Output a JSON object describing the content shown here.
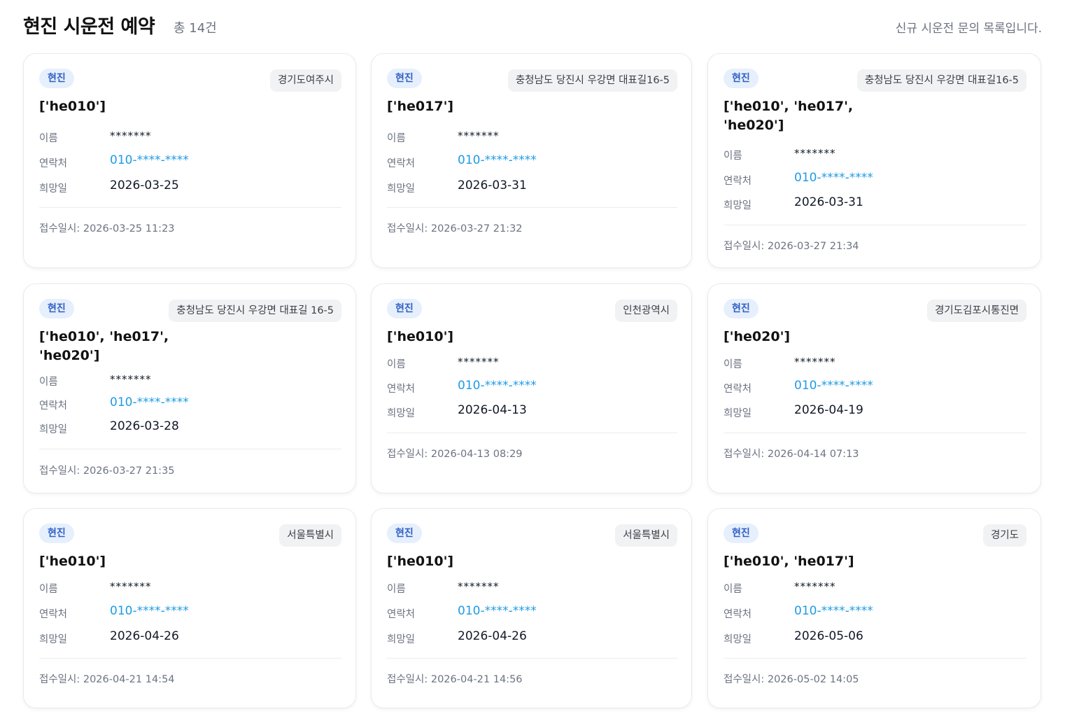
{
  "header": {
    "title": "현진 시운전 예약",
    "count": "총 14건",
    "subtitle": "신규 시운전 문의 목록입니다."
  },
  "labels": {
    "name": "이름",
    "contact": "연락처",
    "desired_date": "희망일"
  },
  "cards": [
    {
      "badge": "현진",
      "region": "경기도여주시",
      "equipment": "['he010']",
      "name": "*******",
      "phone": "010-****-****",
      "desired_date": "2026-03-25",
      "received": "접수일시: 2026-03-25 11:23"
    },
    {
      "badge": "현진",
      "region": "충청남도 당진시 우강면 대표길16-5",
      "equipment": "['he017']",
      "name": "*******",
      "phone": "010-****-****",
      "desired_date": "2026-03-31",
      "received": "접수일시: 2026-03-27 21:32"
    },
    {
      "badge": "현진",
      "region": "충청남도 당진시 우강면 대표길16-5",
      "equipment": "['he010', 'he017', 'he020']",
      "name": "*******",
      "phone": "010-****-****",
      "desired_date": "2026-03-31",
      "received": "접수일시: 2026-03-27 21:34"
    },
    {
      "badge": "현진",
      "region": "충청남도 당진시 우강면 대표길 16-5",
      "equipment": "['he010', 'he017', 'he020']",
      "name": "*******",
      "phone": "010-****-****",
      "desired_date": "2026-03-28",
      "received": "접수일시: 2026-03-27 21:35"
    },
    {
      "badge": "현진",
      "region": "인천광역시",
      "equipment": "['he010']",
      "name": "*******",
      "phone": "010-****-****",
      "desired_date": "2026-04-13",
      "received": "접수일시: 2026-04-13 08:29"
    },
    {
      "badge": "현진",
      "region": "경기도김포시통진면",
      "equipment": "['he020']",
      "name": "*******",
      "phone": "010-****-****",
      "desired_date": "2026-04-19",
      "received": "접수일시: 2026-04-14 07:13"
    },
    {
      "badge": "현진",
      "region": "서울특별시",
      "equipment": "['he010']",
      "name": "*******",
      "phone": "010-****-****",
      "desired_date": "2026-04-26",
      "received": "접수일시: 2026-04-21 14:54"
    },
    {
      "badge": "현진",
      "region": "서울특별시",
      "equipment": "['he010']",
      "name": "*******",
      "phone": "010-****-****",
      "desired_date": "2026-04-26",
      "received": "접수일시: 2026-04-21 14:56"
    },
    {
      "badge": "현진",
      "region": "경기도",
      "equipment": "['he010', 'he017']",
      "name": "*******",
      "phone": "010-****-****",
      "desired_date": "2026-05-06",
      "received": "접수일시: 2026-05-02 14:05"
    }
  ]
}
